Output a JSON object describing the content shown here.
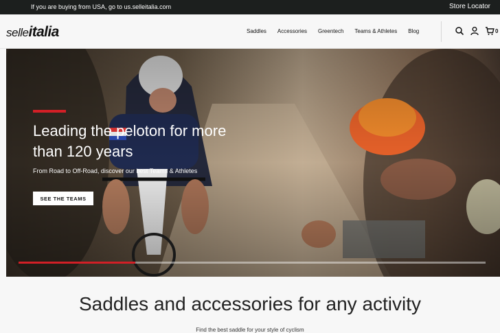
{
  "topbar": {
    "promo": "If you are buying from USA, go to us.selleitalia.com",
    "store_locator": "Store Locator"
  },
  "header": {
    "logo_part1": "selle",
    "logo_part2": "italia",
    "nav": [
      "Saddles",
      "Accessories",
      "Greentech",
      "Teams & Athletes",
      "Blog"
    ],
    "cart_count": "0"
  },
  "hero": {
    "title": "Leading the peloton for more than 120 years",
    "subtitle": "From Road to Off-Road, discover our best Teams & Athletes",
    "cta": "SEE THE TEAMS",
    "slide_progress": 0.25
  },
  "section": {
    "title": "Saddles and accessories for any activity",
    "subtitle": "Find the best saddle for your style of cyclism"
  },
  "colors": {
    "accent": "#d21f26",
    "topbar": "#1c1f1e"
  }
}
